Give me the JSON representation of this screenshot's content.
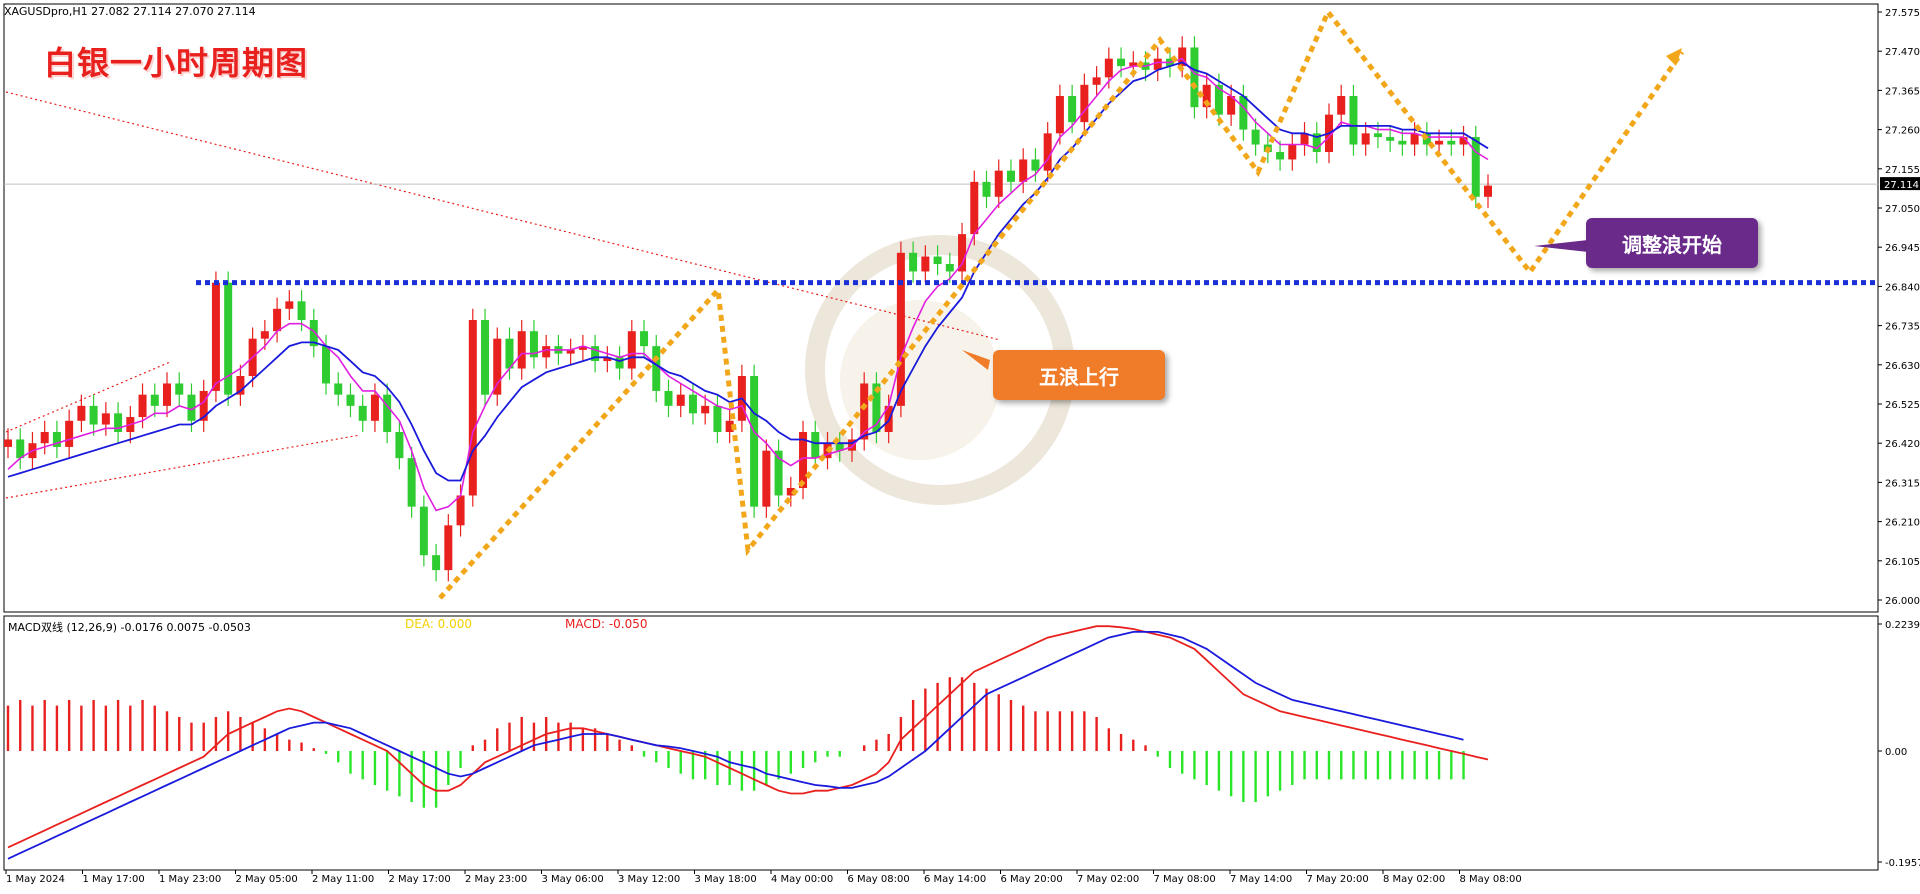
{
  "header": {
    "symbol_line": "XAGUSDpro,H1  27.082 27.114 27.070 27.114",
    "overlay_title": "白银一小时周期图"
  },
  "annotations": {
    "wave_up": "五浪上行",
    "correction": "调整浪开始"
  },
  "macd_panel": {
    "header": "MACD双线 (12,26,9) -0.0176 0.0075 -0.0503",
    "dea_label": "DEA: 0.000",
    "macd_label": "MACD: -0.050"
  },
  "colors": {
    "bull": "#e8201e",
    "bear": "#2ecc31",
    "ma_fast": "#e020e0",
    "ma_slow": "#1a1adc",
    "support_line": "#1a2fd8",
    "zigzag": "#f2a71b",
    "callout_orange": "#f07c2a",
    "callout_purple": "#6a2a8a"
  },
  "chart_data": [
    {
      "type": "candlestick",
      "symbol": "XAGUSDpro",
      "timeframe": "H1",
      "ylim": [
        26.0,
        27.575
      ],
      "yticks": [
        "27.575",
        "27.470",
        "27.365",
        "27.260",
        "27.155",
        "27.050",
        "26.945",
        "26.840",
        "26.735",
        "26.630",
        "26.525",
        "26.420",
        "26.315",
        "26.210",
        "26.105",
        "26.000"
      ],
      "current_price": "27.114",
      "xticks": [
        "1 May 2024",
        "1 May 17:00",
        "1 May 23:00",
        "2 May 05:00",
        "2 May 11:00",
        "2 May 17:00",
        "2 May 23:00",
        "3 May 06:00",
        "3 May 12:00",
        "3 May 18:00",
        "4 May 00:00",
        "6 May 08:00",
        "6 May 14:00",
        "6 May 20:00",
        "7 May 02:00",
        "7 May 08:00",
        "7 May 14:00",
        "7 May 20:00",
        "8 May 02:00",
        "8 May 08:00"
      ],
      "support_level": 26.85,
      "close": [
        26.43,
        26.38,
        26.42,
        26.45,
        26.41,
        26.48,
        26.52,
        26.47,
        26.5,
        26.45,
        26.49,
        26.55,
        26.52,
        26.58,
        26.55,
        26.48,
        26.56,
        26.85,
        26.55,
        26.6,
        26.7,
        26.72,
        26.78,
        26.8,
        26.75,
        26.68,
        26.58,
        26.55,
        26.52,
        26.48,
        26.55,
        26.45,
        26.38,
        26.25,
        26.12,
        26.08,
        26.2,
        26.28,
        26.75,
        26.55,
        26.7,
        26.62,
        26.72,
        26.65,
        26.68,
        26.66,
        26.67,
        26.68,
        26.64,
        26.65,
        26.62,
        26.72,
        26.68,
        26.56,
        26.52,
        26.55,
        26.5,
        26.52,
        26.45,
        26.48,
        26.6,
        26.25,
        26.4,
        26.28,
        26.3,
        26.45,
        26.38,
        26.42,
        26.4,
        26.43,
        26.58,
        26.45,
        26.52,
        26.93,
        26.88,
        26.92,
        26.9,
        26.88,
        26.98,
        27.12,
        27.08,
        27.15,
        27.12,
        27.18,
        27.15,
        27.25,
        27.35,
        27.28,
        27.38,
        27.4,
        27.45,
        27.43,
        27.44,
        27.42,
        27.45,
        27.43,
        27.48,
        27.32,
        27.38,
        27.3,
        27.35,
        27.26,
        27.22,
        27.2,
        27.18,
        27.22,
        27.25,
        27.2,
        27.3,
        27.35,
        27.22,
        27.25,
        27.24,
        27.23,
        27.22,
        27.25,
        27.22,
        27.23,
        27.22,
        27.24,
        27.08,
        27.11
      ],
      "ma_fast": [
        26.35,
        26.38,
        26.4,
        26.41,
        26.42,
        26.43,
        26.44,
        26.45,
        26.46,
        26.46,
        26.47,
        26.48,
        26.5,
        26.5,
        26.52,
        26.51,
        26.53,
        26.58,
        26.6,
        26.62,
        26.65,
        26.68,
        26.72,
        26.74,
        26.74,
        26.72,
        26.68,
        26.65,
        26.6,
        26.56,
        26.56,
        26.52,
        26.48,
        26.4,
        26.3,
        26.24,
        26.25,
        26.28,
        26.45,
        26.52,
        26.58,
        26.62,
        26.66,
        26.66,
        26.67,
        26.67,
        26.67,
        26.68,
        26.67,
        26.66,
        26.65,
        26.66,
        26.66,
        26.63,
        26.6,
        26.58,
        26.56,
        26.54,
        26.52,
        26.51,
        26.52,
        26.45,
        26.42,
        26.38,
        26.36,
        26.38,
        26.38,
        26.39,
        26.4,
        26.41,
        26.45,
        26.47,
        26.52,
        26.65,
        26.73,
        26.8,
        26.84,
        26.86,
        26.9,
        26.98,
        27.02,
        27.06,
        27.09,
        27.12,
        27.14,
        27.18,
        27.24,
        27.27,
        27.31,
        27.35,
        27.39,
        27.42,
        27.43,
        27.43,
        27.44,
        27.44,
        27.45,
        27.41,
        27.4,
        27.37,
        27.35,
        27.32,
        27.28,
        27.25,
        27.22,
        27.22,
        27.22,
        27.21,
        27.24,
        27.28,
        27.27,
        27.27,
        27.26,
        27.26,
        27.25,
        27.25,
        27.24,
        27.24,
        27.24,
        27.24,
        27.2,
        27.18
      ],
      "ma_slow": [
        26.33,
        26.34,
        26.35,
        26.36,
        26.37,
        26.38,
        26.39,
        26.4,
        26.41,
        26.42,
        26.43,
        26.44,
        26.45,
        26.46,
        26.47,
        26.47,
        26.49,
        26.52,
        26.54,
        26.56,
        26.59,
        26.62,
        26.65,
        26.68,
        26.69,
        26.69,
        26.68,
        26.67,
        26.64,
        26.61,
        26.6,
        26.57,
        26.53,
        26.47,
        26.4,
        26.34,
        26.32,
        26.32,
        26.4,
        26.44,
        26.49,
        26.53,
        26.57,
        26.59,
        26.61,
        26.62,
        26.63,
        26.64,
        26.65,
        26.65,
        26.64,
        26.65,
        26.65,
        26.63,
        26.61,
        26.6,
        26.58,
        26.56,
        26.55,
        26.53,
        26.54,
        26.5,
        26.48,
        26.45,
        26.43,
        26.43,
        26.42,
        26.42,
        26.42,
        26.42,
        26.44,
        26.45,
        26.48,
        26.56,
        26.62,
        26.68,
        26.73,
        26.77,
        26.81,
        26.88,
        26.93,
        26.98,
        27.02,
        27.06,
        27.09,
        27.13,
        27.18,
        27.21,
        27.25,
        27.29,
        27.33,
        27.36,
        27.39,
        27.4,
        27.42,
        27.43,
        27.44,
        27.42,
        27.41,
        27.39,
        27.37,
        27.35,
        27.32,
        27.29,
        27.26,
        27.25,
        27.25,
        27.24,
        27.25,
        27.27,
        27.27,
        27.27,
        27.27,
        27.27,
        27.26,
        27.26,
        27.25,
        27.25,
        27.25,
        27.25,
        27.23,
        27.21
      ]
    },
    {
      "type": "macd",
      "title": "MACD双线 (12,26,9)",
      "ylim": [
        -0.1957,
        0.2239
      ],
      "yticks": [
        "0.2239",
        "0.00",
        "-0.1957"
      ],
      "macd": [
        -0.17,
        -0.16,
        -0.15,
        -0.14,
        -0.13,
        -0.12,
        -0.11,
        -0.1,
        -0.09,
        -0.08,
        -0.07,
        -0.06,
        -0.05,
        -0.04,
        -0.03,
        -0.02,
        -0.01,
        0.01,
        0.03,
        0.04,
        0.05,
        0.06,
        0.07,
        0.075,
        0.07,
        0.06,
        0.05,
        0.04,
        0.03,
        0.02,
        0.01,
        0.0,
        -0.02,
        -0.04,
        -0.06,
        -0.07,
        -0.07,
        -0.06,
        -0.04,
        -0.02,
        -0.01,
        0.0,
        0.01,
        0.02,
        0.03,
        0.035,
        0.04,
        0.04,
        0.035,
        0.03,
        0.025,
        0.02,
        0.015,
        0.01,
        0.005,
        0.0,
        -0.005,
        -0.01,
        -0.02,
        -0.03,
        -0.04,
        -0.05,
        -0.06,
        -0.07,
        -0.075,
        -0.075,
        -0.07,
        -0.07,
        -0.065,
        -0.06,
        -0.05,
        -0.04,
        -0.02,
        0.02,
        0.04,
        0.06,
        0.08,
        0.1,
        0.12,
        0.14,
        0.15,
        0.16,
        0.17,
        0.18,
        0.19,
        0.2,
        0.205,
        0.21,
        0.215,
        0.22,
        0.22,
        0.218,
        0.215,
        0.21,
        0.205,
        0.2,
        0.19,
        0.18,
        0.16,
        0.14,
        0.12,
        0.1,
        0.09,
        0.08,
        0.07,
        0.065,
        0.06,
        0.055,
        0.05,
        0.045,
        0.04,
        0.035,
        0.03,
        0.025,
        0.02,
        0.015,
        0.01,
        0.005,
        0.0,
        -0.005,
        -0.01,
        -0.015
      ],
      "dea": [
        -0.19,
        -0.18,
        -0.17,
        -0.16,
        -0.15,
        -0.14,
        -0.13,
        -0.12,
        -0.11,
        -0.1,
        -0.09,
        -0.08,
        -0.07,
        -0.06,
        -0.05,
        -0.04,
        -0.03,
        -0.02,
        -0.01,
        0.0,
        0.01,
        0.02,
        0.03,
        0.04,
        0.045,
        0.05,
        0.05,
        0.045,
        0.04,
        0.03,
        0.02,
        0.01,
        0.0,
        -0.01,
        -0.02,
        -0.03,
        -0.04,
        -0.045,
        -0.04,
        -0.03,
        -0.02,
        -0.01,
        0.0,
        0.01,
        0.015,
        0.02,
        0.025,
        0.03,
        0.03,
        0.03,
        0.025,
        0.02,
        0.015,
        0.01,
        0.008,
        0.005,
        0.0,
        -0.005,
        -0.01,
        -0.02,
        -0.025,
        -0.03,
        -0.04,
        -0.045,
        -0.05,
        -0.055,
        -0.06,
        -0.062,
        -0.065,
        -0.065,
        -0.06,
        -0.055,
        -0.045,
        -0.03,
        -0.015,
        0.0,
        0.02,
        0.04,
        0.06,
        0.08,
        0.1,
        0.11,
        0.12,
        0.13,
        0.14,
        0.15,
        0.16,
        0.17,
        0.18,
        0.19,
        0.2,
        0.205,
        0.21,
        0.21,
        0.21,
        0.205,
        0.2,
        0.19,
        0.18,
        0.165,
        0.15,
        0.135,
        0.12,
        0.11,
        0.1,
        0.09,
        0.085,
        0.08,
        0.075,
        0.07,
        0.065,
        0.06,
        0.055,
        0.05,
        0.045,
        0.04,
        0.035,
        0.03,
        0.025,
        0.02
      ],
      "histogram": [
        0.08,
        0.09,
        0.08,
        0.09,
        0.08,
        0.09,
        0.08,
        0.09,
        0.08,
        0.09,
        0.08,
        0.09,
        0.08,
        0.07,
        0.06,
        0.05,
        0.05,
        0.06,
        0.07,
        0.06,
        0.05,
        0.04,
        0.03,
        0.02,
        0.015,
        0.005,
        -0.005,
        -0.02,
        -0.04,
        -0.05,
        -0.06,
        -0.07,
        -0.08,
        -0.09,
        -0.1,
        -0.1,
        -0.06,
        -0.03,
        0.01,
        0.02,
        0.04,
        0.05,
        0.06,
        0.05,
        0.06,
        0.05,
        0.05,
        0.04,
        0.04,
        0.03,
        0.02,
        0.01,
        -0.01,
        -0.02,
        -0.03,
        -0.04,
        -0.05,
        -0.05,
        -0.06,
        -0.06,
        -0.07,
        -0.07,
        -0.06,
        -0.05,
        -0.04,
        -0.03,
        -0.02,
        -0.01,
        -0.01,
        0.0,
        0.01,
        0.02,
        0.03,
        0.06,
        0.09,
        0.11,
        0.12,
        0.13,
        0.13,
        0.12,
        0.11,
        0.1,
        0.09,
        0.08,
        0.07,
        0.07,
        0.07,
        0.07,
        0.07,
        0.06,
        0.04,
        0.03,
        0.02,
        0.01,
        -0.01,
        -0.03,
        -0.04,
        -0.05,
        -0.06,
        -0.07,
        -0.08,
        -0.09,
        -0.09,
        -0.08,
        -0.07,
        -0.06,
        -0.05,
        -0.05,
        -0.05,
        -0.05,
        -0.05,
        -0.05,
        -0.05,
        -0.05,
        -0.05,
        -0.05,
        -0.05,
        -0.05,
        -0.05,
        -0.05
      ]
    }
  ]
}
